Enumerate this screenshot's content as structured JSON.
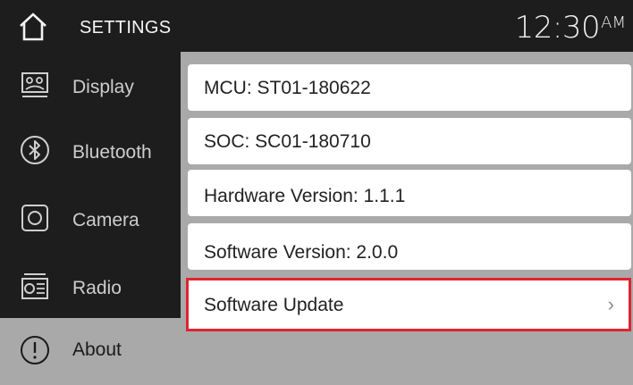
{
  "header": {
    "title": "SETTINGS",
    "time": "12:30",
    "ampm": "AM",
    "home_icon": "home-icon"
  },
  "sidebar": {
    "items": [
      {
        "label": "Display",
        "icon": "display-icon"
      },
      {
        "label": "Bluetooth",
        "icon": "bluetooth-icon"
      },
      {
        "label": "Camera",
        "icon": "camera-icon"
      },
      {
        "label": "Radio",
        "icon": "radio-icon"
      },
      {
        "label": "About",
        "icon": "info-icon",
        "selected": true
      }
    ]
  },
  "content": {
    "rows": [
      {
        "text": "MCU: ST01-180622"
      },
      {
        "text": "SOC: SC01-180710"
      },
      {
        "text": "Hardware Version: 1.1.1"
      },
      {
        "text": "Software Version: 2.0.0"
      },
      {
        "text": "Software Update",
        "chevron": "›",
        "highlighted": true
      }
    ]
  },
  "colors": {
    "header_bg": "#1d1d1d",
    "sidebar_bg": "#1d1d1d",
    "content_bg": "#a9a9a9",
    "highlight": "#e02431"
  }
}
